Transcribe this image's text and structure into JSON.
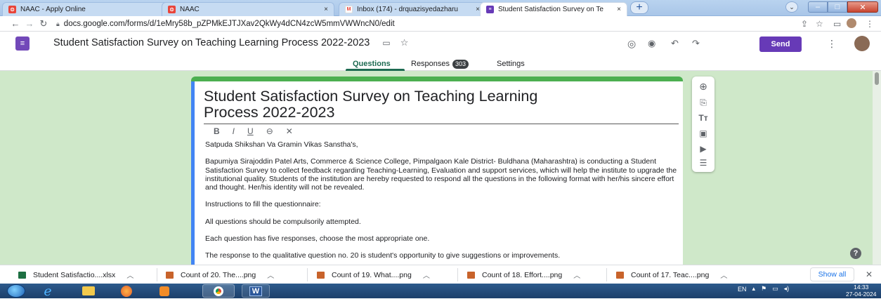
{
  "browser": {
    "tabs": [
      {
        "title": "NAAC - Apply Online",
        "close": "×",
        "color": "#e8443a"
      },
      {
        "title": "NAAC",
        "close": "×",
        "color": "#e8443a"
      },
      {
        "title": "Inbox (174) - drquazisyedazharu",
        "close": "×",
        "color": "#ea4335"
      },
      {
        "title": "Student Satisfaction Survey on Te",
        "close": "×",
        "color": "#673ab7"
      }
    ],
    "new_tab": "+",
    "url": "docs.google.com/forms/d/1eMry58b_pZPMkEJTJXav2QkWy4dCN4zcW5mmVWWncN0/edit"
  },
  "form_header": {
    "title": "Student Satisfaction Survey on Teaching Learning Process 2022-2023",
    "send": "Send",
    "tabs": {
      "questions": "Questions",
      "responses": "Responses",
      "response_count": "303",
      "settings": "Settings"
    }
  },
  "form": {
    "title_line1": "Student Satisfaction Survey on Teaching Learning",
    "title_line2": "Process 2022-2023",
    "format_tools": [
      "B",
      "I",
      "U",
      "⊖",
      "✕"
    ],
    "description": [
      "Satpuda Shikshan Va Gramin Vikas Sanstha's,",
      "Bapumiya Sirajoddin Patel Arts, Commerce & Science College, Pimpalgaon Kale District- Buldhana (Maharashtra) is conducting a Student Satisfaction Survey to collect feedback regarding Teaching-Learning, Evaluation and support services, which will help the institute to upgrade the institutional quality. Students of the institution are hereby requested to respond all the questions in the following format with her/his sincere effort and thought. Her/his identity will not be revealed.",
      "Instructions to fill the questionnaire:",
      "All questions should be compulsorily attempted.",
      "Each question has five responses, choose the most appropriate one.",
      "The response to the qualitative question no. 20 is student's opportunity to give suggestions or improvements."
    ]
  },
  "downloads": [
    {
      "name": "Student Satisfactio....xlsx",
      "color": "#1d6f42"
    },
    {
      "name": "Count of 20. The....png",
      "color": "#c8632b"
    },
    {
      "name": "Count of 19. What....png",
      "color": "#c8632b"
    },
    {
      "name": "Count of 18. Effort....png",
      "color": "#c8632b"
    },
    {
      "name": "Count of 17. Teac....png",
      "color": "#c8632b"
    }
  ],
  "show_all": "Show all",
  "taskbar": {
    "lang": "EN",
    "time": "14:33",
    "date": "27-04-2024"
  },
  "colors": {
    "accent": "#673ab7",
    "green": "#1e6b52",
    "bg": "#cfe8c9"
  }
}
